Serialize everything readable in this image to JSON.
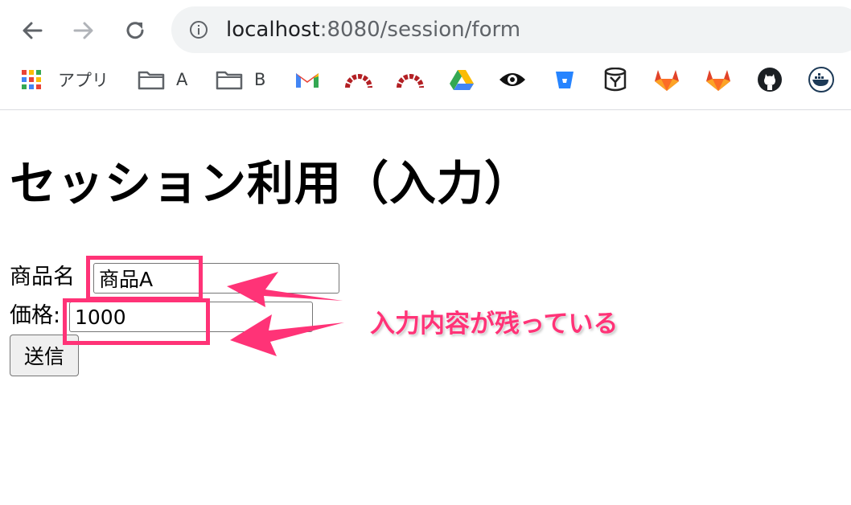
{
  "browser": {
    "url_host": "localhost",
    "url_rest": ":8080/session/form",
    "bookmarks": [
      {
        "label": "アプリ"
      },
      {
        "label": "A"
      },
      {
        "label": "B"
      }
    ]
  },
  "page": {
    "title": "セッション利用（入力）",
    "form": {
      "product_label": "商品名",
      "product_value": "商品A",
      "price_label": "価格:",
      "price_value": "1000",
      "submit_label": "送信"
    }
  },
  "annotation": {
    "text": "入力内容が残っている",
    "color": "#ff3377"
  }
}
